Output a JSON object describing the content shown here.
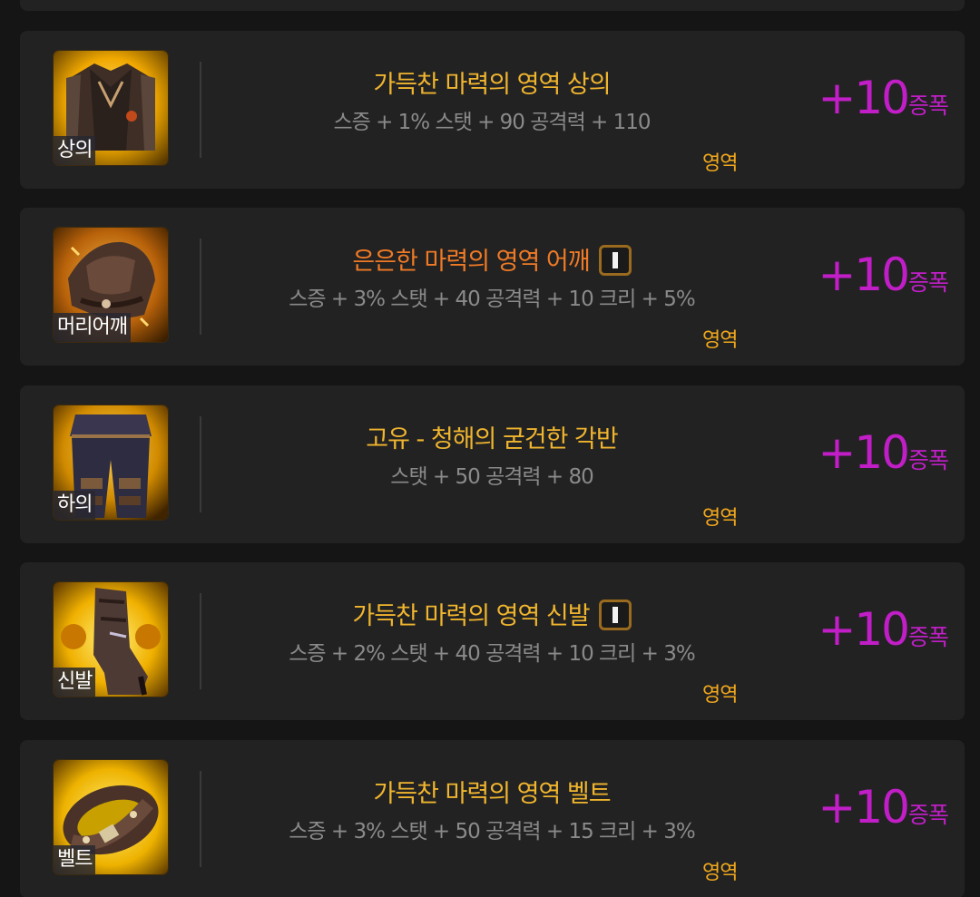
{
  "colors": {
    "page_background": "#151515",
    "card_background": "#222222",
    "name_gold": "#f0b52e",
    "name_orange": "#ef7a26",
    "stats_gray": "#8a8a8a",
    "set_tag_gold": "#f2a81c",
    "enhance_magenta": "#c11ec8"
  },
  "items": [
    {
      "slot": "상의",
      "icon": "top-armor-icon",
      "name": "가득찬 마력의 영역 상의",
      "name_color": "gold",
      "badge": false,
      "stats": "스증 + 1% 스탯 + 90 공격력 + 110",
      "set": "영역",
      "enhance_value": "+10",
      "enhance_label": "증폭"
    },
    {
      "slot": "머리어깨",
      "icon": "shoulder-armor-icon",
      "name": "은은한 마력의 영역 어깨",
      "name_color": "orange",
      "badge": true,
      "badge_icon": "tune-level-i-icon",
      "stats": "스증 + 3% 스탯 + 40 공격력 + 10 크리 + 5%",
      "set": "영역",
      "enhance_value": "+10",
      "enhance_label": "증폭"
    },
    {
      "slot": "하의",
      "icon": "pants-armor-icon",
      "name": "고유 - 청해의 굳건한 각반",
      "name_color": "gold",
      "badge": false,
      "stats": "스탯 + 50 공격력 + 80",
      "set": "영역",
      "enhance_value": "+10",
      "enhance_label": "증폭"
    },
    {
      "slot": "신발",
      "icon": "boots-armor-icon",
      "name": "가득찬 마력의 영역 신발",
      "name_color": "gold",
      "badge": true,
      "badge_icon": "tune-level-i-icon",
      "stats": "스증 + 2% 스탯 + 40 공격력 + 10 크리 + 3%",
      "set": "영역",
      "enhance_value": "+10",
      "enhance_label": "증폭"
    },
    {
      "slot": "벨트",
      "icon": "belt-armor-icon",
      "name": "가득찬 마력의 영역 벨트",
      "name_color": "gold",
      "badge": false,
      "stats": "스증 + 3% 스탯 + 50 공격력 + 15 크리 + 3%",
      "set": "영역",
      "enhance_value": "+10",
      "enhance_label": "증폭"
    }
  ]
}
